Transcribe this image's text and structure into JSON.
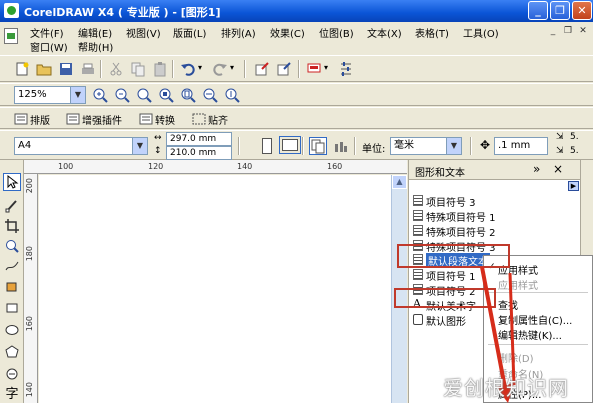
{
  "window": {
    "title": "CorelDRAW X4 ( 专业版 ) - [图形1]",
    "minimize_label": "_",
    "restore_label": "❐",
    "close_label": "✕"
  },
  "menu": {
    "row1": [
      "文件(F)",
      "编辑(E)",
      "视图(V)",
      "版面(L)",
      "排列(A)",
      "效果(C)",
      "位图(B)",
      "文本(X)",
      "表格(T)",
      "工具(O)"
    ],
    "row2": [
      "窗口(W)",
      "帮助(H)"
    ],
    "mdi_minimize": "_",
    "mdi_restore": "❐",
    "mdi_close": "✕"
  },
  "zoom": {
    "value": "125%"
  },
  "plugin_toolbar": {
    "items": [
      "排版",
      "增强插件",
      "转换",
      "贴齐"
    ]
  },
  "property_bar": {
    "page_size": "A4",
    "width": "297.0 mm",
    "height": "210.0 mm",
    "units_label": "单位:",
    "units_value": "毫米",
    "nudge": ".1 mm",
    "dup_x": "5.",
    "dup_y": "5."
  },
  "ruler": {
    "h_ticks": [
      "100",
      "120",
      "140",
      "160"
    ],
    "v_ticks": [
      "200",
      "180",
      "160",
      "140"
    ]
  },
  "docker": {
    "title": "图形和文本",
    "expand_label": "»",
    "close_label": "×",
    "styles": [
      {
        "label": "项目符号 3",
        "type": "text"
      },
      {
        "label": "特殊项目符号 1",
        "type": "text"
      },
      {
        "label": "特殊项目符号 2",
        "type": "text"
      },
      {
        "label": "特殊项目符号 3",
        "type": "text"
      },
      {
        "label": "默认段落文本",
        "type": "text",
        "selected": true
      },
      {
        "label": "项目符号 1",
        "type": "text"
      },
      {
        "label": "项目符号 2",
        "type": "text"
      },
      {
        "label": "默认美术字",
        "type": "art"
      },
      {
        "label": "默认图形",
        "type": "shape"
      }
    ]
  },
  "context_menu": {
    "items": [
      {
        "label": "应用样式",
        "checked": true,
        "disabled": false
      },
      {
        "label": "应用样式",
        "checked": false,
        "disabled": true
      },
      {
        "label": "查找",
        "disabled": false
      },
      {
        "label": "复制属性自(C)...",
        "disabled": false
      },
      {
        "label": "编辑热键(K)...",
        "disabled": false
      },
      {
        "label": "删除(D)",
        "disabled": true
      },
      {
        "label": "重命名(N)",
        "disabled": true
      },
      {
        "label": "属性(P)...",
        "disabled": false
      }
    ]
  },
  "watermark": {
    "text": "爱创根知识网"
  },
  "colors": {
    "title_blue": "#0a54d6",
    "highlight_red": "#c0392b",
    "selection_blue": "#316ac5"
  }
}
